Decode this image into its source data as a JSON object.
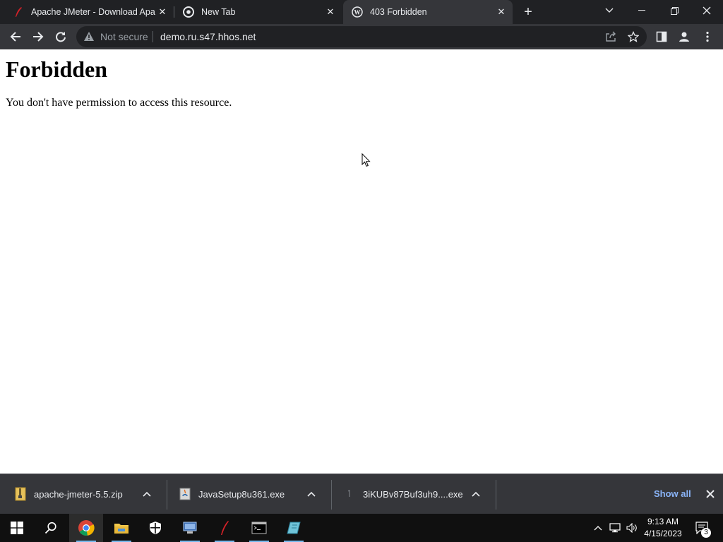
{
  "browser": {
    "tabs": [
      {
        "title": "Apache JMeter - Download Apac",
        "icon": "feather-icon",
        "active": false
      },
      {
        "title": "New Tab",
        "icon": "chrome-icon",
        "active": false
      },
      {
        "title": "403 Forbidden",
        "icon": "wordpress-icon",
        "active": true
      }
    ],
    "address": {
      "security_label": "Not secure",
      "url": "demo.ru.s47.hhos.net"
    }
  },
  "page": {
    "heading": "Forbidden",
    "message": "You don't have permission to access this resource."
  },
  "downloads": {
    "items": [
      {
        "name": "apache-jmeter-5.5.zip",
        "icon": "zip-file-icon"
      },
      {
        "name": "JavaSetup8u361.exe",
        "icon": "java-installer-icon"
      },
      {
        "name": "3iKUBv87Buf3uh9....exe",
        "icon": "exe-file-icon"
      }
    ],
    "show_all_label": "Show all"
  },
  "taskbar": {
    "time": "9:13 AM",
    "date": "4/15/2023",
    "notification_count": "3"
  },
  "colors": {
    "tab_strip": "#202124",
    "toolbar": "#35363a",
    "link": "#8ab4f8",
    "taskbar": "#101010"
  }
}
